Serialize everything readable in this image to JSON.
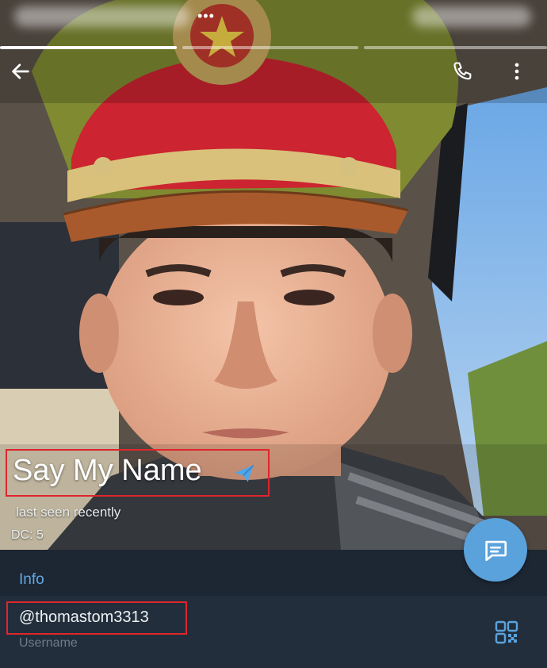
{
  "profile": {
    "name": "Say My Name",
    "last_seen": "last seen recently",
    "dc": "DC: 5"
  },
  "status_bar": {
    "dots": "•••"
  },
  "info": {
    "section_title": "Info",
    "username": "@thomastom3313",
    "username_label": "Username"
  },
  "icons": {
    "back": "arrow-left-icon",
    "call": "phone-icon",
    "more": "more-vertical-icon",
    "verified_send": "telegram-send-icon",
    "message": "message-icon",
    "qr": "qr-code-icon"
  },
  "colors": {
    "accent": "#5aa2dc",
    "section_title": "#62a8e6",
    "highlight_box": "#e0252c",
    "background": "#1d2733",
    "row_background": "#222e3b"
  }
}
